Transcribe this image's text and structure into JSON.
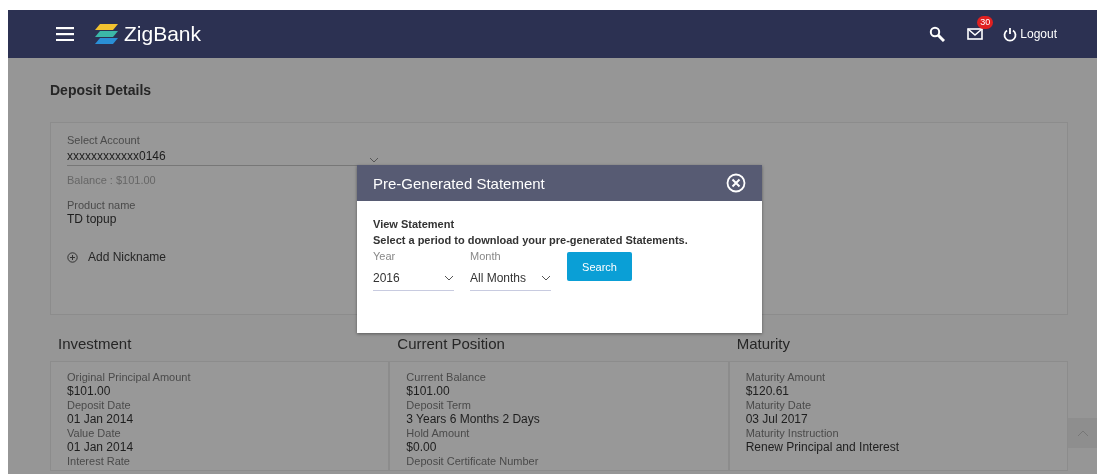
{
  "header": {
    "brand": "ZigBank",
    "mail_badge": "30",
    "logout": "Logout"
  },
  "page_title": "Deposit Details",
  "account": {
    "label": "Select Account",
    "value": "xxxxxxxxxxxx0146",
    "balance": "Balance : $101.00",
    "product_label": "Product name",
    "product_value": "TD topup",
    "add_nickname": "Add Nickname"
  },
  "sections": [
    {
      "title": "Investment",
      "fields": [
        {
          "label": "Original Principal Amount",
          "value": "$101.00"
        },
        {
          "label": "Deposit Date",
          "value": "01 Jan 2014"
        },
        {
          "label": "Value Date",
          "value": "01 Jan 2014"
        },
        {
          "label": "Interest Rate"
        }
      ]
    },
    {
      "title": "Current Position",
      "fields": [
        {
          "label": "Current Balance",
          "value": "$101.00"
        },
        {
          "label": "Deposit Term",
          "value": "3 Years 6 Months 2 Days"
        },
        {
          "label": "Hold Amount",
          "value": "$0.00"
        },
        {
          "label": "Deposit Certificate Number"
        }
      ]
    },
    {
      "title": "Maturity",
      "fields": [
        {
          "label": "Maturity Amount",
          "value": "$120.61"
        },
        {
          "label": "Maturity Date",
          "value": "03 Jul 2017"
        },
        {
          "label": "Maturity Instruction",
          "value": "Renew Principal and Interest"
        }
      ]
    }
  ],
  "modal": {
    "title": "Pre-Generated Statement",
    "heading": "View Statement",
    "instruction": "Select a period to download your pre-generated Statements.",
    "year": {
      "label": "Year",
      "value": "2016"
    },
    "month": {
      "label": "Month",
      "value": "All Months"
    },
    "search_button": "Search"
  }
}
